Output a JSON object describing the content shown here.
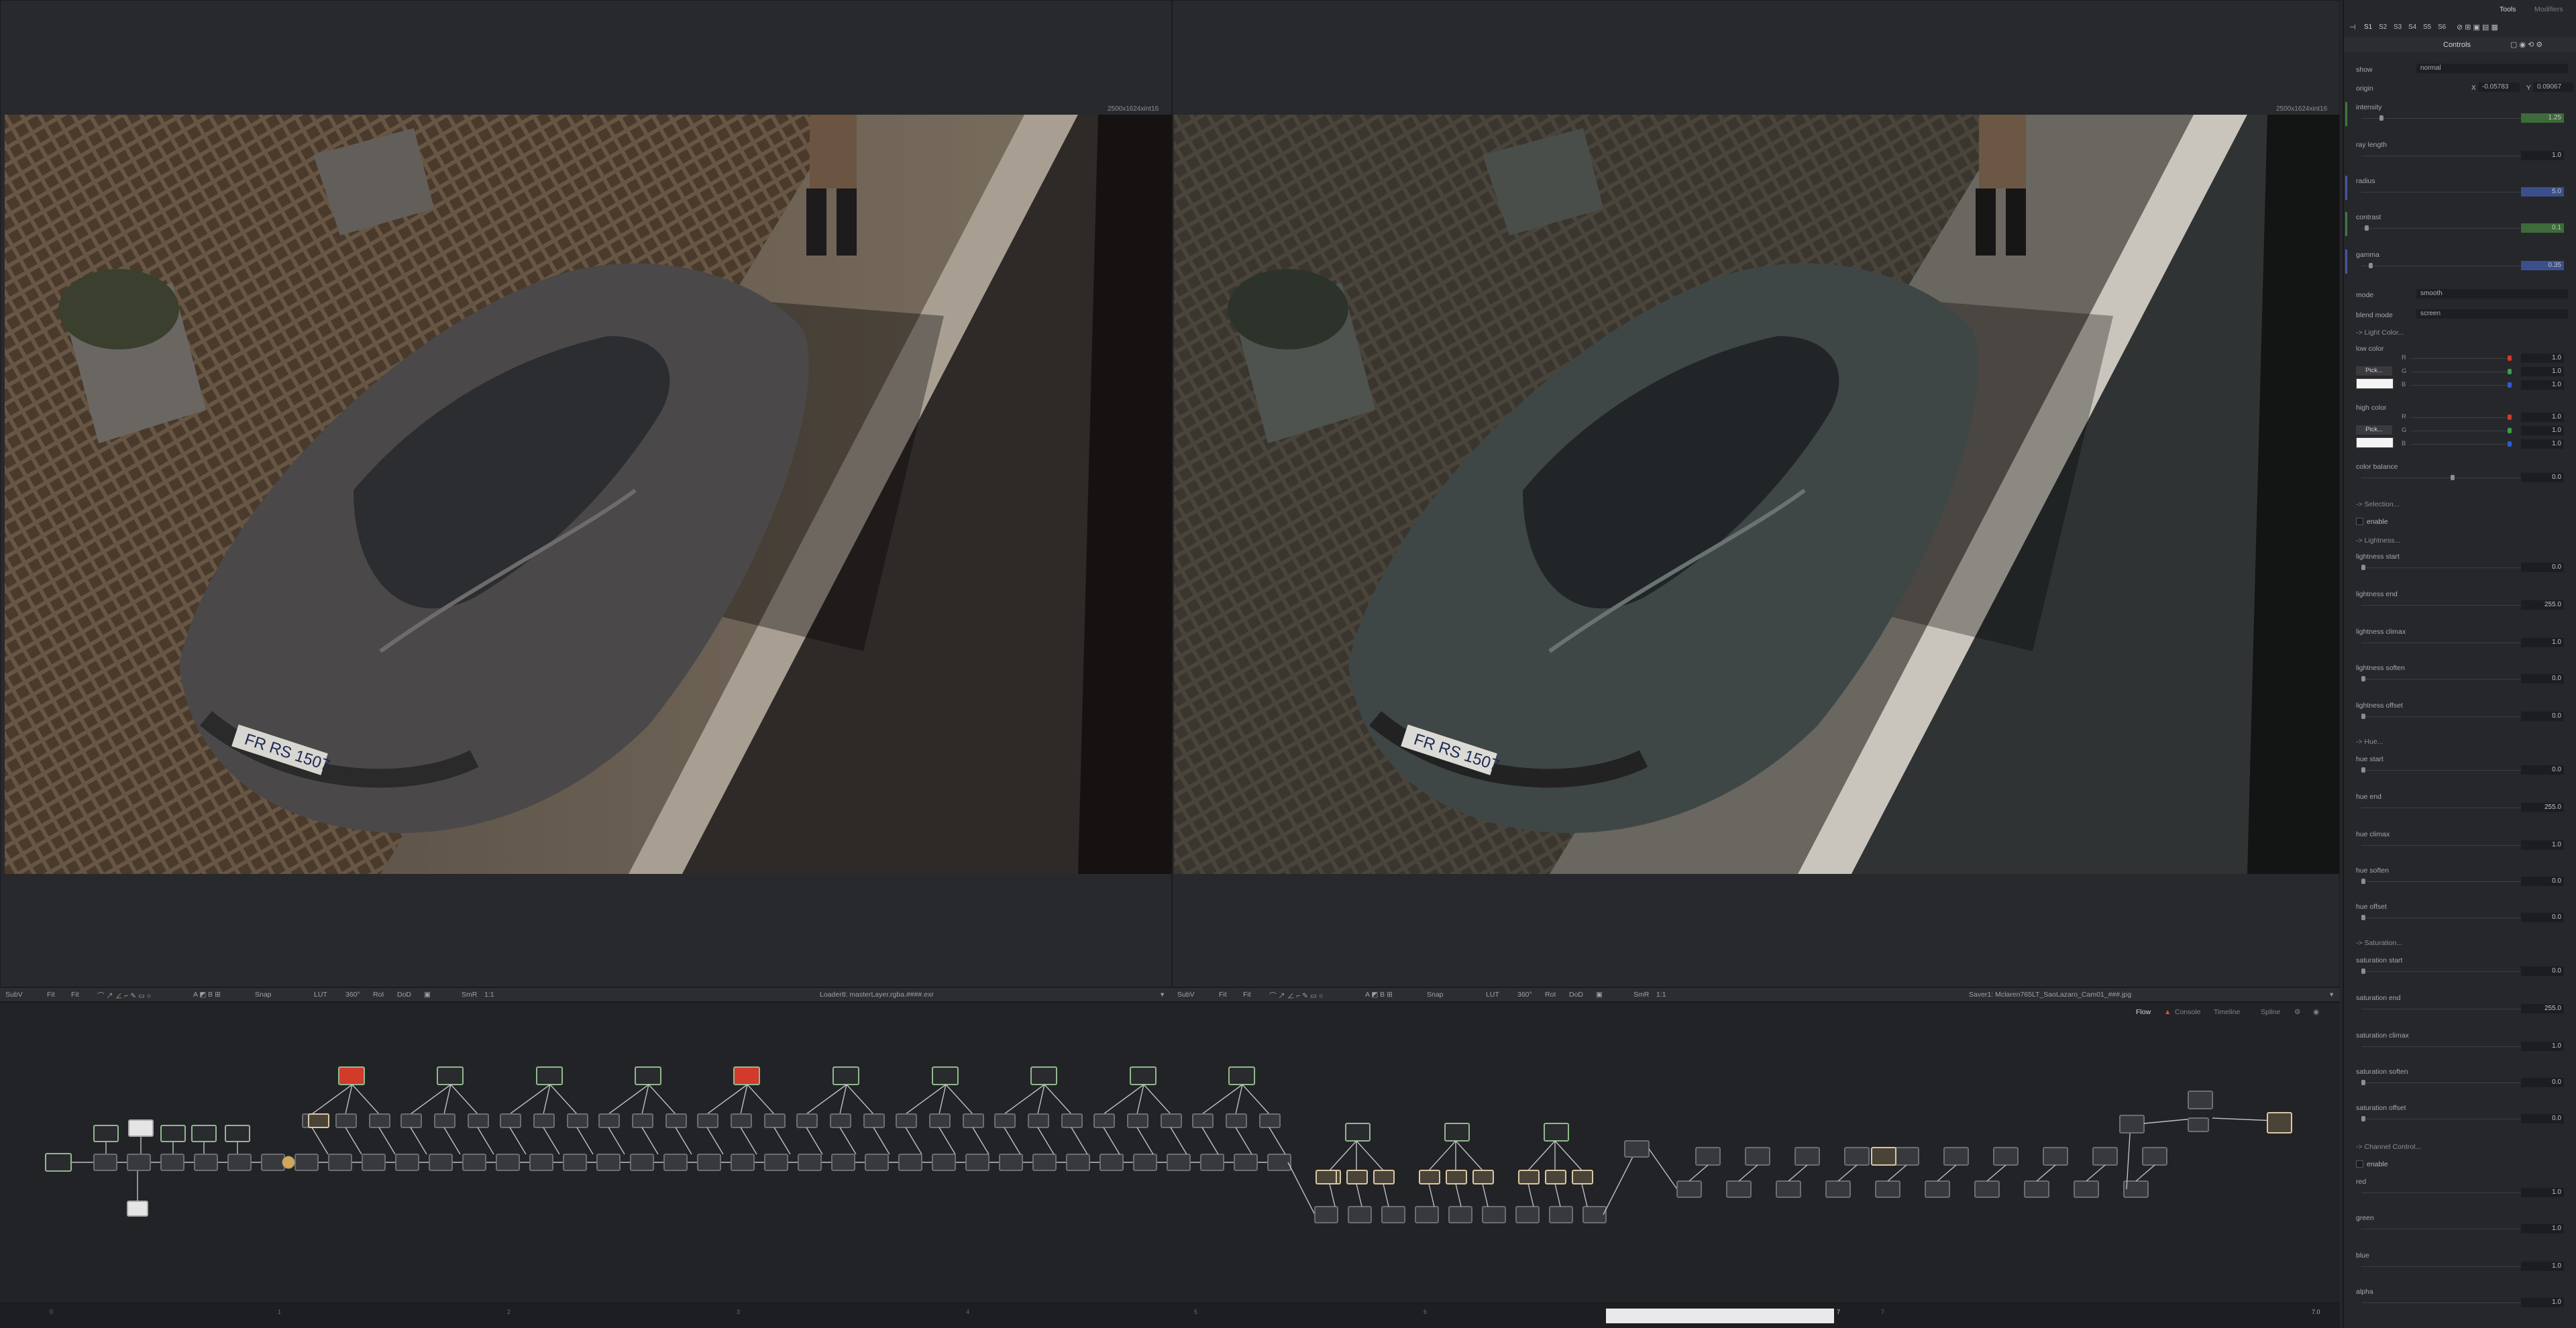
{
  "left_viewer": {
    "resolution": "2500x1624xint16",
    "toolbar": {
      "subv": "SubV",
      "fit1": "Fit",
      "fit2": "Fit",
      "snap": "Snap",
      "lut": "LUT",
      "angle": "360°",
      "roi": "RoI",
      "dod": "DoD",
      "smr": "SmR",
      "ratio": "1:1",
      "title": "Loader8: masterLayer.rgba.####.exr"
    }
  },
  "right_viewer": {
    "resolution": "2500x1624xint16",
    "toolbar": {
      "subv": "SubV",
      "fit1": "Fit",
      "fit2": "Fit",
      "snap": "Snap",
      "lut": "LUT",
      "angle": "360°",
      "roi": "RoI",
      "dod": "DoD",
      "smr": "SmR",
      "ratio": "1:1",
      "title": "Saver1: Mclaren765LT_SaoLazaro_Cam01_###.jpg"
    }
  },
  "license_plate": "FR RS 1507",
  "flow_tabs": {
    "flow": "Flow",
    "console": "Console",
    "timeline": "Timeline",
    "spline": "Spline"
  },
  "timeline": {
    "ticks": [
      "0",
      "1",
      "2",
      "3",
      "4",
      "5",
      "6",
      "7"
    ],
    "current_frame": "7",
    "end_value": "7.0"
  },
  "panel": {
    "tabs": {
      "tools": "Tools",
      "modifiers": "Modifiers"
    },
    "slots": [
      "S1",
      "S2",
      "S3",
      "S4",
      "S5",
      "S6"
    ],
    "controls_label": "Controls",
    "show": {
      "label": "show",
      "value": "normal"
    },
    "origin": {
      "label": "origin",
      "x_label": "X",
      "x": "-0.05783",
      "y_label": "Y",
      "y": "0.09067"
    },
    "intensity": {
      "label": "intensity",
      "value": "1.25"
    },
    "ray_length": {
      "label": "ray length",
      "value": "1.0"
    },
    "radius": {
      "label": "radius",
      "value": "5.0"
    },
    "contrast": {
      "label": "contrast",
      "value": "0.1"
    },
    "gamma": {
      "label": "gamma",
      "value": "0.35"
    },
    "mode": {
      "label": "mode",
      "value": "smooth"
    },
    "blend_mode": {
      "label": "blend mode",
      "value": "screen"
    },
    "light_color_section": "-> Light Color...",
    "low_color": {
      "label": "low color",
      "pick": "Pick...",
      "r": "1.0",
      "g": "1.0",
      "b": "1.0"
    },
    "high_color": {
      "label": "high color",
      "pick": "Pick...",
      "r": "1.0",
      "g": "1.0",
      "b": "1.0"
    },
    "channel_letters": {
      "r": "R",
      "g": "G",
      "b": "B"
    },
    "color_balance": {
      "label": "color balance",
      "value": "0.0"
    },
    "selection_section": "-> Selection...",
    "enable_label": "enable",
    "lightness_section": "-> Lightness...",
    "lightness_start": {
      "label": "lightness start",
      "value": "0.0"
    },
    "lightness_end": {
      "label": "lightness end",
      "value": "255.0"
    },
    "lightness_climax": {
      "label": "lightness climax",
      "value": "1.0"
    },
    "lightness_soften": {
      "label": "lightness soften",
      "value": "0.0"
    },
    "lightness_offset": {
      "label": "lightness offset",
      "value": "0.0"
    },
    "hue_section": "-> Hue...",
    "hue_start": {
      "label": "hue start",
      "value": "0.0"
    },
    "hue_end": {
      "label": "hue end",
      "value": "255.0"
    },
    "hue_climax": {
      "label": "hue climax",
      "value": "1.0"
    },
    "hue_soften": {
      "label": "hue soften",
      "value": "0.0"
    },
    "hue_offset": {
      "label": "hue offset",
      "value": "0.0"
    },
    "saturation_section": "-> Saturation...",
    "saturation_start": {
      "label": "saturation start",
      "value": "0.0"
    },
    "saturation_end": {
      "label": "saturation end",
      "value": "255.0"
    },
    "saturation_climax": {
      "label": "saturation climax",
      "value": "1.0"
    },
    "saturation_soften": {
      "label": "saturation soften",
      "value": "0.0"
    },
    "saturation_offset": {
      "label": "saturation offset",
      "value": "0.0"
    },
    "channel_section": "-> Channel Control...",
    "channel_enable_label": "enable",
    "red": {
      "label": "red",
      "value": "1.0"
    },
    "green": {
      "label": "green",
      "value": "1.0"
    },
    "blue": {
      "label": "blue",
      "value": "1.0"
    },
    "alpha": {
      "label": "alpha",
      "value": "1.0"
    }
  },
  "colors": {
    "accent_green_value": "#3d6b3a",
    "accent_blue_value": "#3b4f8c",
    "node_green_border": "#8fb98d",
    "node_red": "#d23a2c"
  }
}
